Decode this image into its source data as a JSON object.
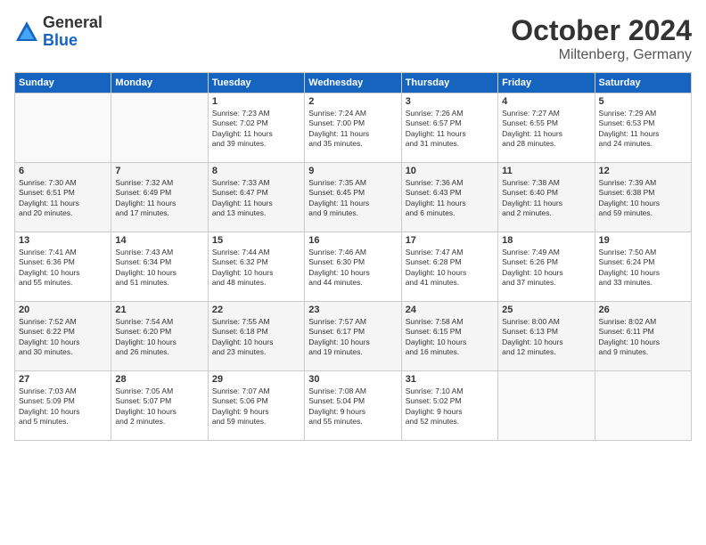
{
  "header": {
    "logo_general": "General",
    "logo_blue": "Blue",
    "month": "October 2024",
    "location": "Miltenberg, Germany"
  },
  "days_of_week": [
    "Sunday",
    "Monday",
    "Tuesday",
    "Wednesday",
    "Thursday",
    "Friday",
    "Saturday"
  ],
  "weeks": [
    [
      {
        "day": "",
        "info": ""
      },
      {
        "day": "",
        "info": ""
      },
      {
        "day": "1",
        "info": "Sunrise: 7:23 AM\nSunset: 7:02 PM\nDaylight: 11 hours\nand 39 minutes."
      },
      {
        "day": "2",
        "info": "Sunrise: 7:24 AM\nSunset: 7:00 PM\nDaylight: 11 hours\nand 35 minutes."
      },
      {
        "day": "3",
        "info": "Sunrise: 7:26 AM\nSunset: 6:57 PM\nDaylight: 11 hours\nand 31 minutes."
      },
      {
        "day": "4",
        "info": "Sunrise: 7:27 AM\nSunset: 6:55 PM\nDaylight: 11 hours\nand 28 minutes."
      },
      {
        "day": "5",
        "info": "Sunrise: 7:29 AM\nSunset: 6:53 PM\nDaylight: 11 hours\nand 24 minutes."
      }
    ],
    [
      {
        "day": "6",
        "info": "Sunrise: 7:30 AM\nSunset: 6:51 PM\nDaylight: 11 hours\nand 20 minutes."
      },
      {
        "day": "7",
        "info": "Sunrise: 7:32 AM\nSunset: 6:49 PM\nDaylight: 11 hours\nand 17 minutes."
      },
      {
        "day": "8",
        "info": "Sunrise: 7:33 AM\nSunset: 6:47 PM\nDaylight: 11 hours\nand 13 minutes."
      },
      {
        "day": "9",
        "info": "Sunrise: 7:35 AM\nSunset: 6:45 PM\nDaylight: 11 hours\nand 9 minutes."
      },
      {
        "day": "10",
        "info": "Sunrise: 7:36 AM\nSunset: 6:43 PM\nDaylight: 11 hours\nand 6 minutes."
      },
      {
        "day": "11",
        "info": "Sunrise: 7:38 AM\nSunset: 6:40 PM\nDaylight: 11 hours\nand 2 minutes."
      },
      {
        "day": "12",
        "info": "Sunrise: 7:39 AM\nSunset: 6:38 PM\nDaylight: 10 hours\nand 59 minutes."
      }
    ],
    [
      {
        "day": "13",
        "info": "Sunrise: 7:41 AM\nSunset: 6:36 PM\nDaylight: 10 hours\nand 55 minutes."
      },
      {
        "day": "14",
        "info": "Sunrise: 7:43 AM\nSunset: 6:34 PM\nDaylight: 10 hours\nand 51 minutes."
      },
      {
        "day": "15",
        "info": "Sunrise: 7:44 AM\nSunset: 6:32 PM\nDaylight: 10 hours\nand 48 minutes."
      },
      {
        "day": "16",
        "info": "Sunrise: 7:46 AM\nSunset: 6:30 PM\nDaylight: 10 hours\nand 44 minutes."
      },
      {
        "day": "17",
        "info": "Sunrise: 7:47 AM\nSunset: 6:28 PM\nDaylight: 10 hours\nand 41 minutes."
      },
      {
        "day": "18",
        "info": "Sunrise: 7:49 AM\nSunset: 6:26 PM\nDaylight: 10 hours\nand 37 minutes."
      },
      {
        "day": "19",
        "info": "Sunrise: 7:50 AM\nSunset: 6:24 PM\nDaylight: 10 hours\nand 33 minutes."
      }
    ],
    [
      {
        "day": "20",
        "info": "Sunrise: 7:52 AM\nSunset: 6:22 PM\nDaylight: 10 hours\nand 30 minutes."
      },
      {
        "day": "21",
        "info": "Sunrise: 7:54 AM\nSunset: 6:20 PM\nDaylight: 10 hours\nand 26 minutes."
      },
      {
        "day": "22",
        "info": "Sunrise: 7:55 AM\nSunset: 6:18 PM\nDaylight: 10 hours\nand 23 minutes."
      },
      {
        "day": "23",
        "info": "Sunrise: 7:57 AM\nSunset: 6:17 PM\nDaylight: 10 hours\nand 19 minutes."
      },
      {
        "day": "24",
        "info": "Sunrise: 7:58 AM\nSunset: 6:15 PM\nDaylight: 10 hours\nand 16 minutes."
      },
      {
        "day": "25",
        "info": "Sunrise: 8:00 AM\nSunset: 6:13 PM\nDaylight: 10 hours\nand 12 minutes."
      },
      {
        "day": "26",
        "info": "Sunrise: 8:02 AM\nSunset: 6:11 PM\nDaylight: 10 hours\nand 9 minutes."
      }
    ],
    [
      {
        "day": "27",
        "info": "Sunrise: 7:03 AM\nSunset: 5:09 PM\nDaylight: 10 hours\nand 5 minutes."
      },
      {
        "day": "28",
        "info": "Sunrise: 7:05 AM\nSunset: 5:07 PM\nDaylight: 10 hours\nand 2 minutes."
      },
      {
        "day": "29",
        "info": "Sunrise: 7:07 AM\nSunset: 5:06 PM\nDaylight: 9 hours\nand 59 minutes."
      },
      {
        "day": "30",
        "info": "Sunrise: 7:08 AM\nSunset: 5:04 PM\nDaylight: 9 hours\nand 55 minutes."
      },
      {
        "day": "31",
        "info": "Sunrise: 7:10 AM\nSunset: 5:02 PM\nDaylight: 9 hours\nand 52 minutes."
      },
      {
        "day": "",
        "info": ""
      },
      {
        "day": "",
        "info": ""
      }
    ]
  ]
}
